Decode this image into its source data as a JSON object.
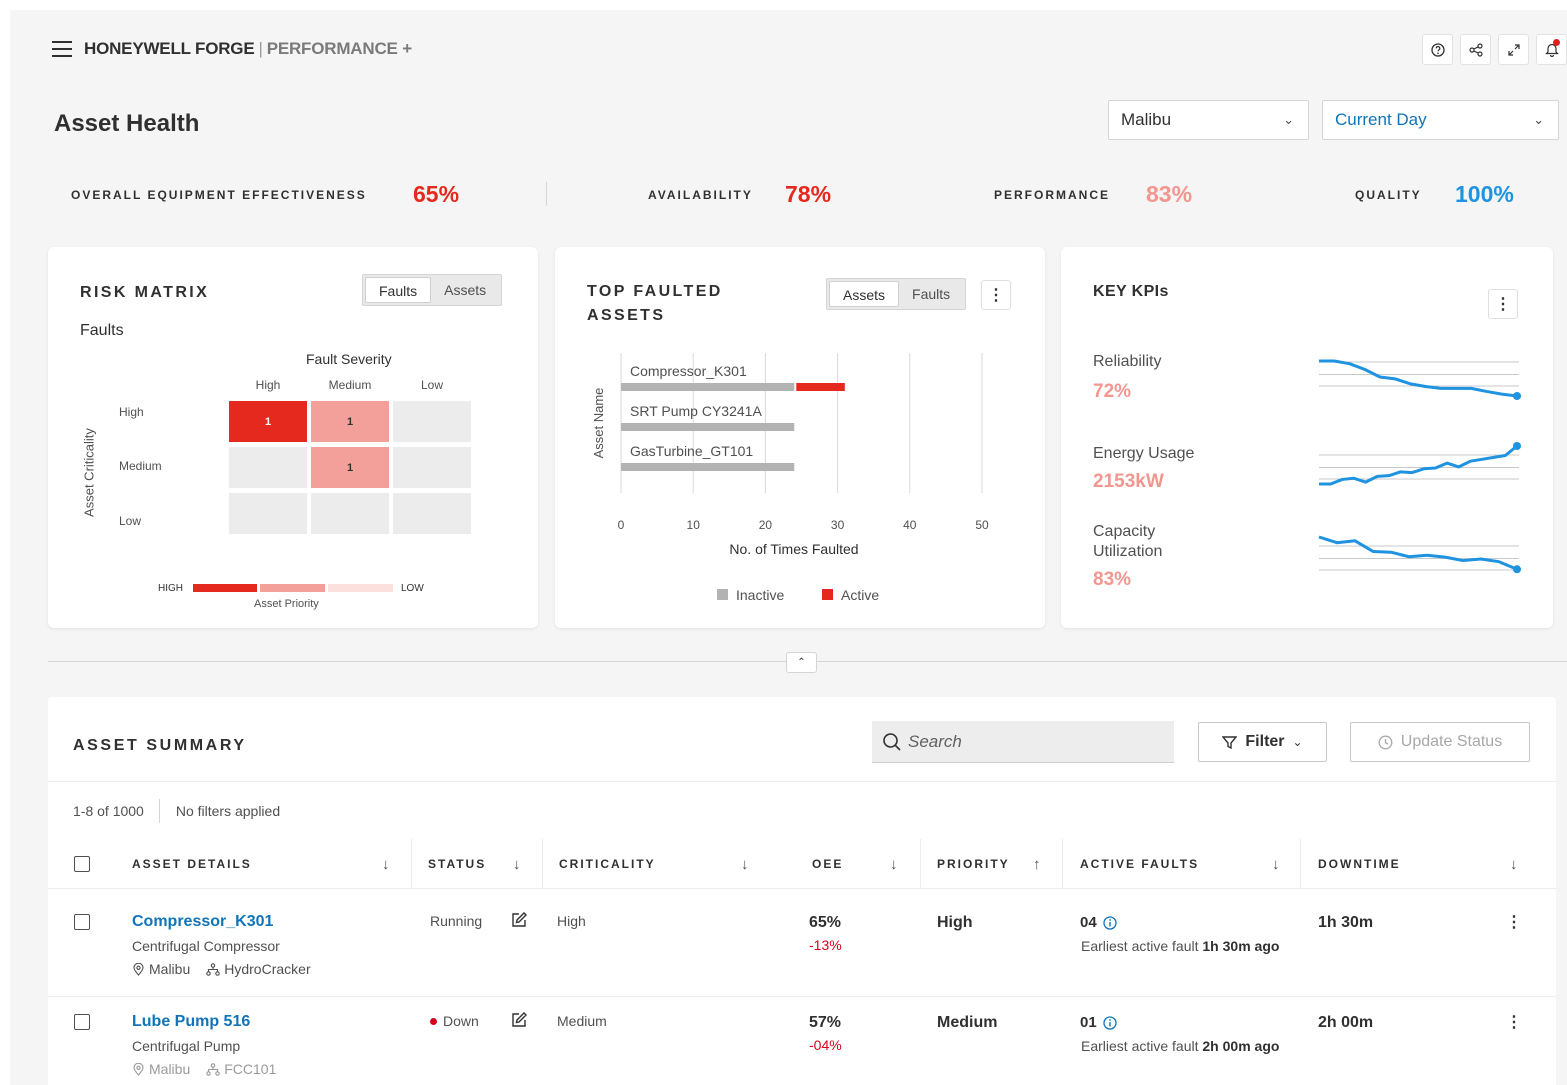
{
  "header": {
    "brand": "HONEYWELL FORGE",
    "separator": "|",
    "product": "PERFORMANCE +",
    "icons": [
      "help-icon",
      "share-icon",
      "expand-icon",
      "bell-icon"
    ]
  },
  "page": {
    "title": "Asset Health",
    "site_select": "Malibu",
    "time_select": "Current Day"
  },
  "kpis": [
    {
      "label": "OVERALL EQUIPMENT EFFECTIVENESS",
      "value": "65%",
      "color": "#e5291e"
    },
    {
      "label": "AVAILABILITY",
      "value": "78%",
      "color": "#e5291e"
    },
    {
      "label": "PERFORMANCE",
      "value": "83%",
      "color": "#f3968f"
    },
    {
      "label": "QUALITY",
      "value": "100%",
      "color": "#1f93e0"
    }
  ],
  "risk_matrix": {
    "title": "RISK MATRIX",
    "toggle": [
      "Faults",
      "Assets"
    ],
    "active_toggle": "Faults",
    "subtitle": "Faults",
    "x_title": "Fault Severity",
    "columns": [
      "High",
      "Medium",
      "Low"
    ],
    "y_title": "Asset Criticality",
    "rows": [
      "High",
      "Medium",
      "Low"
    ],
    "cells": [
      [
        "1",
        "1",
        ""
      ],
      [
        "",
        "1",
        ""
      ],
      [
        "",
        "",
        ""
      ]
    ],
    "legend_high": "HIGH",
    "legend_low": "LOW",
    "legend_caption": "Asset Priority"
  },
  "top_faulted": {
    "title_line1": "TOP FAULTED",
    "title_line2": "ASSETS",
    "toggle": [
      "Assets",
      "Faults"
    ],
    "active_toggle": "Assets",
    "y_title": "Asset Name",
    "x_title": "No. of Times Faulted",
    "legend": [
      "Inactive",
      "Active"
    ],
    "colors": {
      "inactive": "#b3b3b3",
      "active": "#e5291e"
    },
    "chart_data": {
      "type": "bar",
      "orientation": "horizontal",
      "stacked": true,
      "categories": [
        "Compressor_K301",
        "SRT Pump CY3241A",
        "GasTurbine_GT101"
      ],
      "series": [
        {
          "name": "Inactive",
          "values": [
            24,
            24,
            24
          ]
        },
        {
          "name": "Active",
          "values": [
            7,
            0,
            0
          ]
        }
      ],
      "xlabel": "No. of Times Faulted",
      "ylabel": "Asset Name",
      "xlim": [
        0,
        50
      ],
      "xticks": [
        "0",
        "10",
        "20",
        "30",
        "40",
        "50"
      ],
      "grid": true,
      "legend": "bottom"
    }
  },
  "key_kpis": {
    "title": "KEY KPIs",
    "items": [
      {
        "label": "Reliability",
        "value": "72%",
        "trend": [
          0.92,
          0.92,
          0.85,
          0.7,
          0.5,
          0.45,
          0.32,
          0.25,
          0.2,
          0.2,
          0.2,
          0.12,
          0.05,
          0.0
        ]
      },
      {
        "label": "Energy Usage",
        "value": "2153kW",
        "trend": [
          0.0,
          0.0,
          0.12,
          0.15,
          0.05,
          0.2,
          0.22,
          0.32,
          0.3,
          0.4,
          0.42,
          0.55,
          0.45,
          0.6,
          0.65,
          0.7,
          0.75,
          1.0
        ]
      },
      {
        "label": "Capacity",
        "label2": "Utilization",
        "value": "83%",
        "trend": [
          1.0,
          0.85,
          0.9,
          0.62,
          0.6,
          0.48,
          0.52,
          0.47,
          0.38,
          0.42,
          0.35,
          0.15
        ]
      }
    ]
  },
  "summary": {
    "title": "ASSET SUMMARY",
    "search_placeholder": "Search",
    "filter_label": "Filter",
    "update_label": "Update Status",
    "count": "1-8 of 1000",
    "filters_note": "No filters applied",
    "columns": [
      "ASSET DETAILS",
      "STATUS",
      "CRITICALITY",
      "OEE",
      "PRIORITY",
      "ACTIVE FAULTS",
      "DOWNTIME"
    ],
    "rows": [
      {
        "name": "Compressor_K301",
        "type": "Centrifugal Compressor",
        "location": "Malibu",
        "unit": "HydroCracker",
        "status": "Running",
        "criticality": "High",
        "oee": "65%",
        "oee_delta": "-13%",
        "priority": "High",
        "faults": "04",
        "fault_prefix": "Earliest active fault",
        "fault_time": "1h 30m ago",
        "downtime": "1h 30m"
      },
      {
        "name": "Lube Pump 516",
        "type": "Centrifugal Pump",
        "location": "Malibu",
        "unit": "FCC101",
        "status": "Down",
        "criticality": "Medium",
        "oee": "57%",
        "oee_delta": "-04%",
        "priority": "Medium",
        "faults": "01",
        "fault_prefix": "Earliest active fault",
        "fault_time": "2h 00m ago",
        "downtime": "2h 00m"
      }
    ]
  }
}
